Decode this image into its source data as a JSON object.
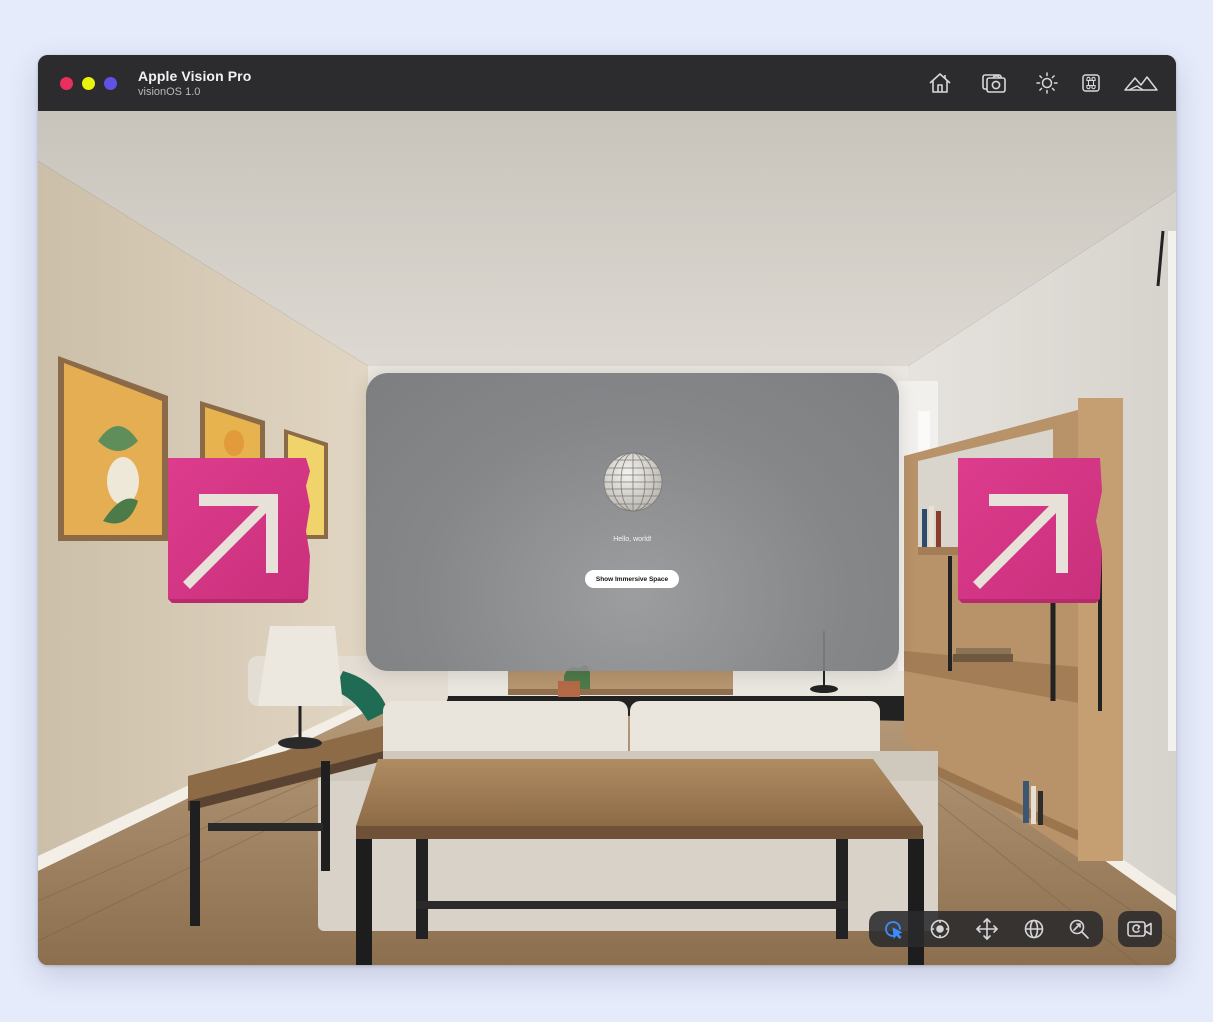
{
  "window": {
    "title": "Apple Vision Pro",
    "subtitle": "visionOS 1.0",
    "traffic_lights": {
      "close": "#ea2f5f",
      "minimize": "#e9f40c",
      "zoom": "#6152e3"
    }
  },
  "toolbar_icons": [
    "home-icon",
    "screenshot-camera-icon",
    "brightness-icon",
    "command-icon",
    "scenery-mountains-icon"
  ],
  "app_window": {
    "greeting": "Hello, world!",
    "button_label": "Show Immersive Space"
  },
  "interaction_tools": [
    {
      "name": "select-tool-icon",
      "active": true
    },
    {
      "name": "look-around-tool-icon",
      "active": false
    },
    {
      "name": "pan-tool-icon",
      "active": false
    },
    {
      "name": "orbit-tool-icon",
      "active": false
    },
    {
      "name": "zoom-tool-icon",
      "active": false
    }
  ],
  "camera_reset_icon": "reset-camera-icon",
  "colors": {
    "active_tool": "#3b8cff",
    "accent_box": "#d63a88",
    "titlebar": "#2c2c2e"
  }
}
